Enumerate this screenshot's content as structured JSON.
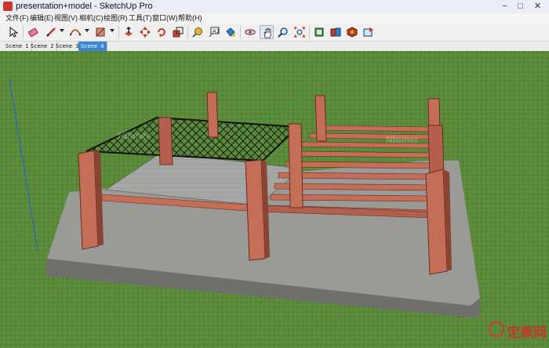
{
  "window": {
    "title": "presentation+model - SketchUp Pro",
    "minimize": "−",
    "maximize": "□",
    "close": "✕"
  },
  "menu": [
    {
      "label": "文件(F)"
    },
    {
      "label": "编辑(E)"
    },
    {
      "label": "视图(V)"
    },
    {
      "label": "相机(C)"
    },
    {
      "label": "绘图(R)"
    },
    {
      "label": "工具(T)"
    },
    {
      "label": "窗口(W)"
    },
    {
      "label": "帮助(H)"
    }
  ],
  "toolbar": {
    "tools": [
      {
        "name": "select-tool",
        "icon": "cursor-icon"
      },
      {
        "name": "eraser-tool",
        "icon": "eraser-icon"
      },
      {
        "name": "pencil-tool",
        "icon": "pencil-icon"
      },
      {
        "name": "arc-tool",
        "icon": "arc-icon"
      },
      {
        "name": "shape-tool",
        "icon": "rectangle-icon"
      },
      {
        "name": "push-pull-tool",
        "icon": "push-pull-icon"
      },
      {
        "name": "move-tool",
        "icon": "move-icon"
      },
      {
        "name": "rotate-tool",
        "icon": "rotate-icon"
      },
      {
        "name": "scale-tool",
        "icon": "scale-icon"
      },
      {
        "name": "tape-measure-tool",
        "icon": "tape-measure-icon"
      },
      {
        "name": "text-tool",
        "icon": "text-icon"
      },
      {
        "name": "paint-bucket-tool",
        "icon": "paint-bucket-icon"
      },
      {
        "name": "orbit-tool",
        "icon": "orbit-icon"
      },
      {
        "name": "pan-tool",
        "icon": "hand-icon",
        "active": true
      },
      {
        "name": "zoom-tool",
        "icon": "magnifier-icon"
      },
      {
        "name": "zoom-extents-tool",
        "icon": "zoom-extents-icon"
      },
      {
        "name": "warehouse-tool",
        "icon": "warehouse-icon"
      },
      {
        "name": "get-models-tool",
        "icon": "get-models-icon"
      },
      {
        "name": "extension-warehouse-tool",
        "icon": "extension-icon"
      },
      {
        "name": "share-model-tool",
        "icon": "share-icon"
      }
    ]
  },
  "scenes": [
    {
      "label": "Scene 1",
      "active": false
    },
    {
      "label": "Scene 2",
      "active": false
    },
    {
      "label": "Scene 3",
      "active": false
    },
    {
      "label": "Scene 4",
      "active": true
    }
  ],
  "watermark": {
    "brand": "定鼎网",
    "faint_left": "Nbimer",
    "faint_right": "Nbimer"
  },
  "colors": {
    "grass": "#5a8a3a",
    "slab_top": "#9a9a96",
    "slab_side": "#6f6f6c",
    "post": "#c46e58",
    "post_dark": "#8a4433",
    "deck": "#a8aaa8",
    "truss": "#1a1a1a",
    "active_scene": "#3b86d6"
  }
}
